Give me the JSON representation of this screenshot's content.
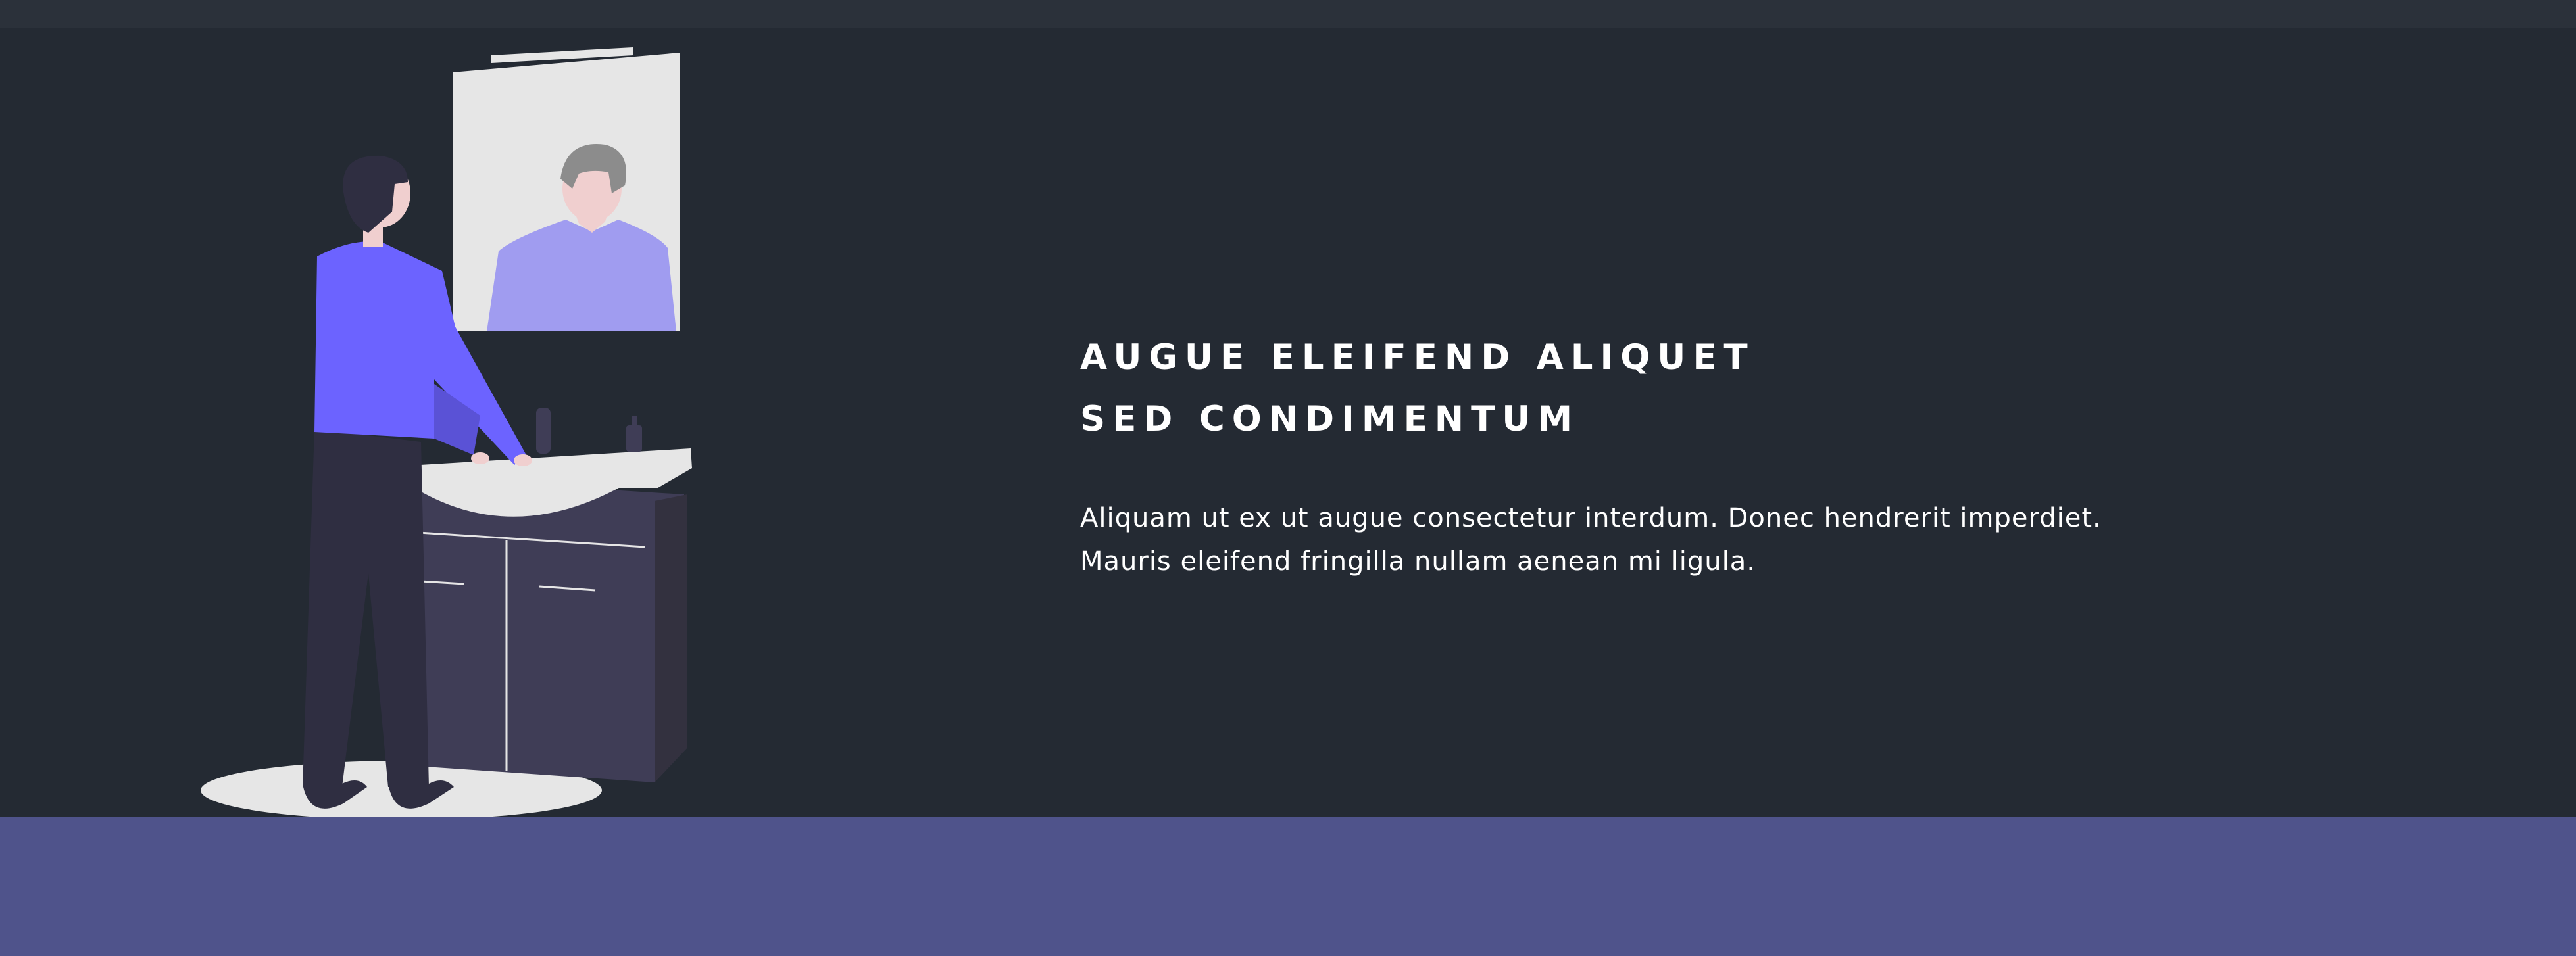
{
  "headline": {
    "line1": "AUGUE ELEIFEND ALIQUET",
    "line2": "SED CONDIMENTUM"
  },
  "description": {
    "line1": "Aliquam ut ex ut augue consectetur interdum. Donec hendrerit imperdiet.",
    "line2": "Mauris eleifend fringilla nullam aenean mi ligula."
  },
  "colors": {
    "background": "#242a33",
    "top_strip": "#2b313a",
    "footer_band": "#4f538b",
    "accent_shirt": "#6c63ff",
    "text": "#ffffff"
  },
  "illustration": "person-at-bathroom-mirror-illustration"
}
